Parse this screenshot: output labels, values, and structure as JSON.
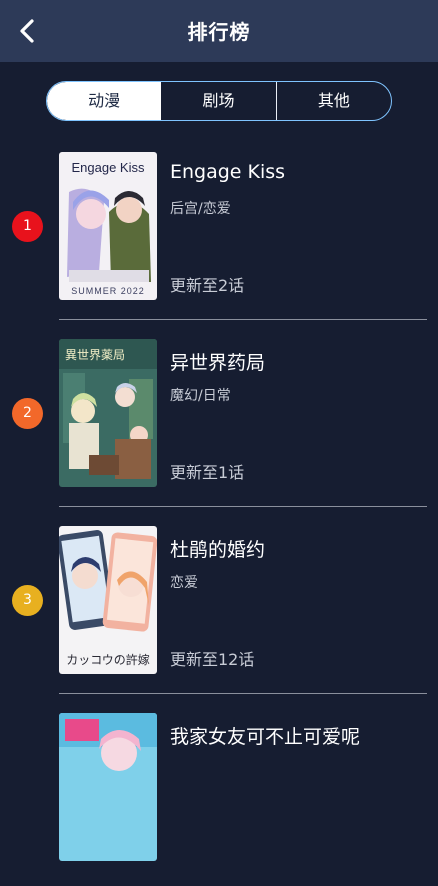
{
  "header": {
    "title": "排行榜",
    "back_icon": "chevron-left-icon"
  },
  "tabs": [
    {
      "label": "动漫",
      "active": true
    },
    {
      "label": "剧场",
      "active": false
    },
    {
      "label": "其他",
      "active": false
    }
  ],
  "colors": {
    "background": "#161d31",
    "header": "#2d3a58",
    "rank_1": "#e8121c",
    "rank_2": "#f2682a",
    "rank_3": "#e8b020",
    "tab_border": "#7fc4ff"
  },
  "ranking": [
    {
      "rank": "1",
      "title": "Engage Kiss",
      "genre": "后宫/恋爱",
      "update": "更新至2话",
      "cover_text": "Engage Kiss",
      "cover_sub": "SUMMER 2022"
    },
    {
      "rank": "2",
      "title": "异世界药局",
      "genre": "魔幻/日常",
      "update": "更新至1话",
      "cover_text": "異世界薬局"
    },
    {
      "rank": "3",
      "title": "杜鹃的婚约",
      "genre": "恋爱",
      "update": "更新至12话",
      "cover_text": "カッコウの許嫁"
    },
    {
      "title": "我家女友可不止可爱呢"
    }
  ]
}
